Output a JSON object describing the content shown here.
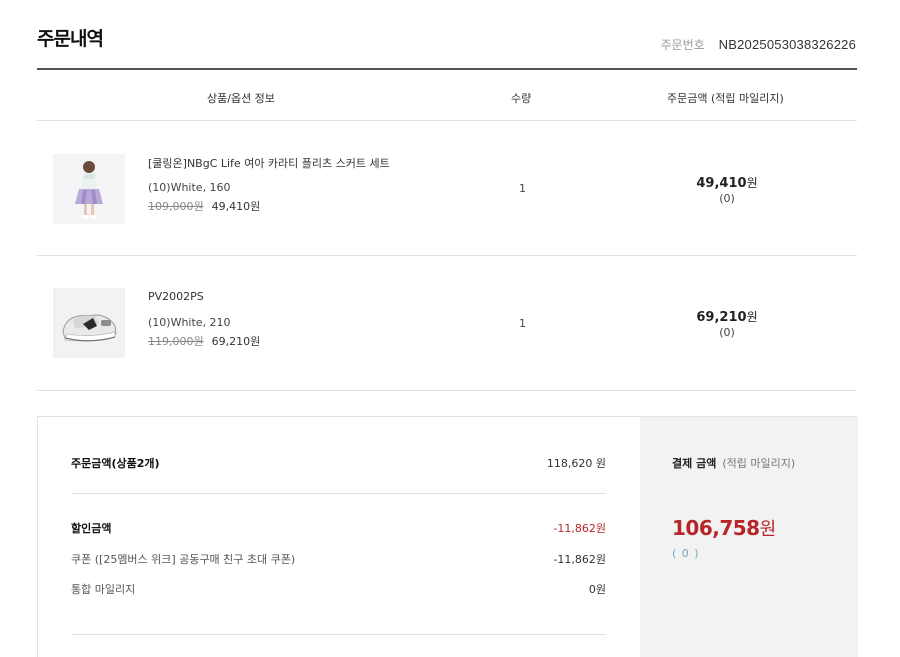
{
  "header": {
    "title": "주문내역",
    "order_number_label": "주문번호",
    "order_number": "NB2025053038326226"
  },
  "table": {
    "columns": [
      "상품/옵션 정보",
      "수량",
      "주문금액 (적립 마일리지)"
    ],
    "items": [
      {
        "name": "[쿨링온]NBgC Life 여아 카라티 플리츠 스커트 세트",
        "option": "(10)White, 160",
        "original_price": "109,000원",
        "sale_price": "49,410원",
        "quantity": "1",
        "amount": "49,410",
        "amount_unit": "원",
        "mileage": "(0)"
      },
      {
        "name": "PV2002PS",
        "option": "(10)White, 210",
        "original_price": "119,000원",
        "sale_price": "69,210원",
        "quantity": "1",
        "amount": "69,210",
        "amount_unit": "원",
        "mileage": "(0)"
      }
    ]
  },
  "summary": {
    "order_amount_label": "주문금액(상품2개)",
    "order_amount": "118,620 원",
    "discount_label": "할인금액",
    "discount_amount": "-11,862원",
    "coupon_label": "쿠폰 ([25멤버스 위크] 공동구매 친구 초대 쿠폰)",
    "coupon_amount": "-11,862원",
    "mileage_label": "통합 마일리지",
    "mileage_amount": "0원"
  },
  "payment": {
    "title": "결제 금액",
    "subtitle": "(적립 마일리지)",
    "total": "106,758",
    "total_unit": "원",
    "mileage": "( 0 )"
  },
  "colors": {
    "accent_red": "#b5262a",
    "mileage_blue": "#7aa6c2",
    "panel_gray": "#f2f2f2"
  }
}
